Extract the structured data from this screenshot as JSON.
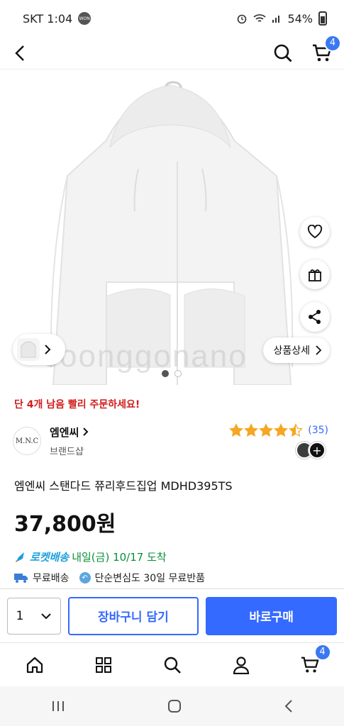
{
  "status_bar": {
    "carrier_time": "SKT 1:04",
    "won_badge": "WON",
    "battery": "54%"
  },
  "top_nav": {
    "cart_count": "4"
  },
  "hero": {
    "watermark": "coonggonano",
    "detail_label": "상품상세"
  },
  "product": {
    "stock_alert": "단 4개 남음 빨리 주문하세요!",
    "brand_logo_text": "M.N.C",
    "brand_name": "엠엔씨",
    "brand_sub": "브랜드샵",
    "rating": 4.5,
    "review_count": "(35)",
    "title": "엠엔씨 스탠다드 쮸리후드집업 MDHD395TS",
    "price": "37,800원",
    "rocket_tag": "로켓배송",
    "delivery_date": "내일(금) 10/17 도착",
    "free_shipping": "무료배송",
    "free_return": "단순변심도 30일 무료반품"
  },
  "purchase": {
    "quantity": "1",
    "add_to_cart": "장바구니 담기",
    "buy_now": "바로구매"
  },
  "tab_bar": {
    "cart_count": "4"
  },
  "colors": {
    "accent": "#346aff",
    "alert": "#d21d1d",
    "rocket_blue": "#1b9fdc",
    "delivery_green": "#0a8f3c",
    "star": "#f5a623"
  }
}
